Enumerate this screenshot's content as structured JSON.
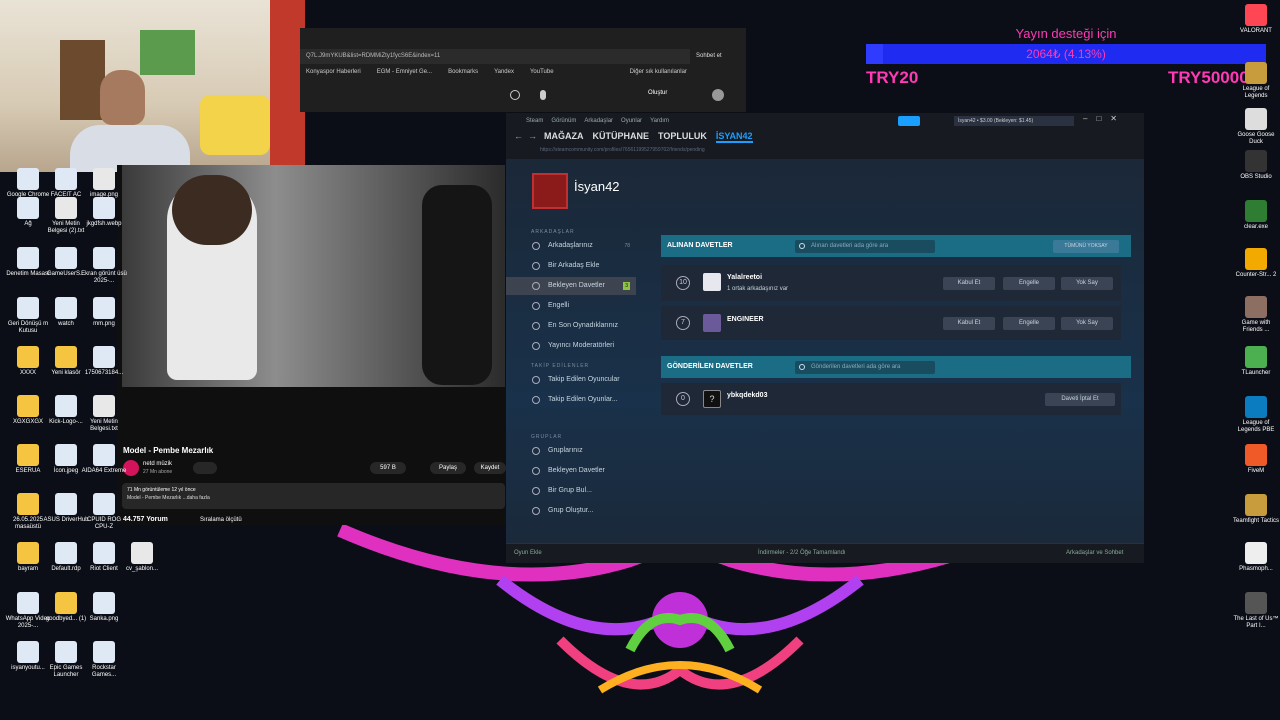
{
  "overlay": {
    "donation_title": "Yayın desteği için",
    "donation_progress_text": "2064₺ (4.13%)",
    "donation_progress": 0.0413,
    "min_label": "TRY20",
    "max_label": "TRY50000",
    "colors": {
      "text": "#ff3ab4",
      "bar": "#1f2bf0"
    }
  },
  "desktop_left": [
    {
      "label": "Google Chrome"
    },
    {
      "label": "FACEIT AC"
    },
    {
      "label": "image.png"
    },
    {
      "label": "Ağ"
    },
    {
      "label": "Yeni Metin Belgesi (2).txt"
    },
    {
      "label": "jkgdfsh.webp"
    },
    {
      "label": "Denetim Masası"
    },
    {
      "label": "GameUserS..."
    },
    {
      "label": "Ekran görünt üsü 2025-..."
    },
    {
      "label": "Geri Dönüşü m Kutusu"
    },
    {
      "label": "watch"
    },
    {
      "label": "mm.png"
    },
    {
      "label": "XXXX"
    },
    {
      "label": "Yeni klasör"
    },
    {
      "label": "1750673184..."
    },
    {
      "label": "XGXGXGX"
    },
    {
      "label": "Kick-Logo-..."
    },
    {
      "label": "Yeni Metin Belgesi.txt"
    },
    {
      "label": "ESERUA"
    },
    {
      "label": "İcon.jpeg"
    },
    {
      "label": "AIDA64 Extreme"
    },
    {
      "label": "26.05.2025 masaüstü"
    },
    {
      "label": "ASUS DriverHub"
    },
    {
      "label": "CPUID ROG CPU-Z"
    },
    {
      "label": "bayram"
    },
    {
      "label": "Default.rdp"
    },
    {
      "label": "Riot Client"
    },
    {
      "label": "cv_şablon..."
    },
    {
      "label": "WhatsApp Video 2025-..."
    },
    {
      "label": "goodbyed... (1)"
    },
    {
      "label": "Sanka.png"
    },
    {
      "label": "isyanyoutu..."
    },
    {
      "label": "Epic Games Launcher"
    },
    {
      "label": "Rockstar Games..."
    }
  ],
  "desktop_right": [
    {
      "label": "VALORANT"
    },
    {
      "label": "League of Legends"
    },
    {
      "label": "Goose Goose Duck"
    },
    {
      "label": "OBS Studio"
    },
    {
      "label": "clear.exe"
    },
    {
      "label": "Counter-Str... 2"
    },
    {
      "label": "Game with Friends ..."
    },
    {
      "label": "TLauncher"
    },
    {
      "label": "League of Legends PBE"
    },
    {
      "label": "FiveM"
    },
    {
      "label": "Teamfight Tactics"
    },
    {
      "label": "Phasmoph..."
    },
    {
      "label": "The Last of Us™ Part I..."
    }
  ],
  "browser": {
    "url_text": "Q7L.J9mYKUB&list=RDMMiZty1fycS6E&index=11",
    "chat_button": "Sohbet et",
    "bookmarks": [
      "Konyaspor Haberleri",
      "EGM - Emniyet Ge...",
      "Bookmarks",
      "Yandex",
      "YouTube"
    ],
    "other_bookmarks": "Diğer sık kullanılanlar",
    "create_button": "Oluştur"
  },
  "youtube": {
    "title": "Model - Pembe Mezarlık",
    "channel": "netd müzik",
    "subscribers": "27 Mn abone",
    "likes": "597 B",
    "share": "Paylaş",
    "save": "Kaydet",
    "stats": "71 Mn görüntüleme  12 yıl önce",
    "description": "Model - Pembe Mezarlık ...daha fazla",
    "comments": "44.757 Yorum",
    "sort": "Sıralama ölçütü"
  },
  "steam": {
    "menu": [
      "Steam",
      "Görünüm",
      "Arkadaşlar",
      "Oyunlar",
      "Yardım"
    ],
    "nav": [
      "MAĞAZA",
      "KÜTÜPHANE",
      "TOPLULUK",
      "İSYAN42"
    ],
    "account": "İsyan42 • $3.00 (Bekleyen: $1.45)",
    "url": "https://steamcommunity.com/profiles/76561199527959702/friends/pending",
    "profile_name": "İsyan42",
    "sections": {
      "friends": "ARKADAŞLAR",
      "following": "TAKİP EDİLENLER",
      "groups": "GRUPLAR"
    },
    "sidebar": [
      {
        "label": "Arkadaşlarınız",
        "badge": "78"
      },
      {
        "label": "Bir Arkadaş Ekle"
      },
      {
        "label": "Bekleyen Davetler",
        "badge": "3"
      },
      {
        "label": "Engelli"
      },
      {
        "label": "En Son Oynadıklarınız"
      },
      {
        "label": "Yayıncı Moderatörleri"
      },
      {
        "label": "Takip Edilen Oyuncular"
      },
      {
        "label": "Takip Edilen Oyunlar..."
      },
      {
        "label": "Gruplarınız"
      },
      {
        "label": "Bekleyen Davetler"
      },
      {
        "label": "Bir Grup Bul..."
      },
      {
        "label": "Grup Oluştur..."
      }
    ],
    "received": {
      "title": "ALINAN DAVETLER",
      "search_placeholder": "Alınan davetleri ada göre ara",
      "ignore_all": "TÜMÜNÜ YOKSAY",
      "items": [
        {
          "level": "10",
          "name": "Yalalreetoi",
          "sub": "1 ortak arkadaşınız var"
        },
        {
          "level": "7",
          "name": "ENGINEER",
          "sub": ""
        }
      ],
      "accept": "Kabul Et",
      "block": "Engelle",
      "ignore": "Yok Say"
    },
    "sent": {
      "title": "GÖNDERİLEN DAVETLER",
      "search_placeholder": "Gönderilen davetleri ada göre ara",
      "items": [
        {
          "level": "0",
          "name": "ybkqdekd03"
        }
      ],
      "cancel": "Daveti İptal Et"
    },
    "footer": {
      "add_game": "Oyun Ekle",
      "downloads": "İndirmeler - 2/2 Öğe Tamamlandı",
      "friends_chat": "Arkadaşlar ve Sohbet"
    }
  }
}
